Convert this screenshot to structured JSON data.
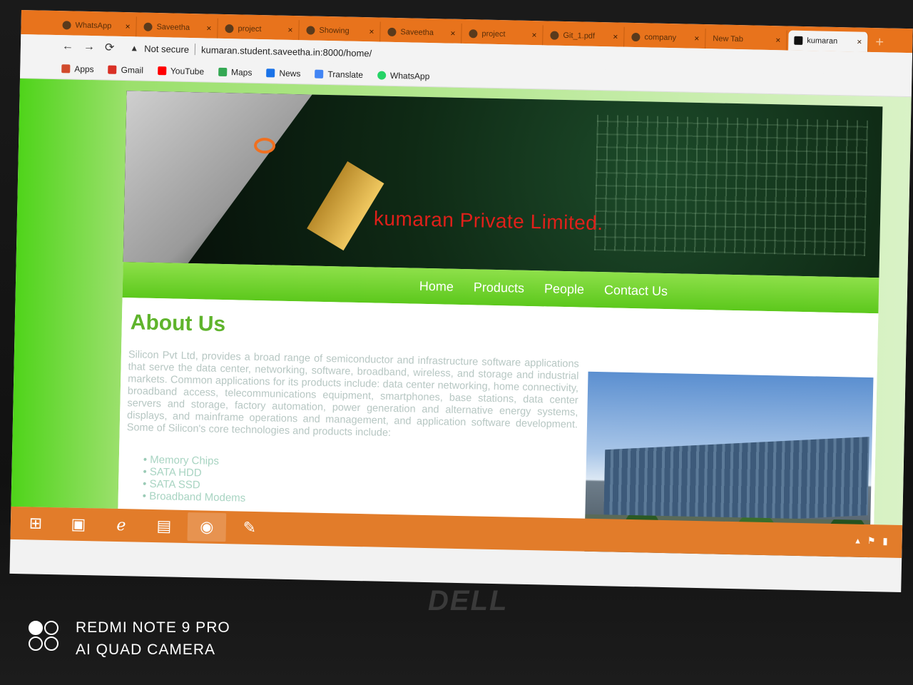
{
  "browser": {
    "tabs": [
      {
        "label": "WhatsApp"
      },
      {
        "label": "Saveetha"
      },
      {
        "label": "project"
      },
      {
        "label": "Showing"
      },
      {
        "label": "Saveetha"
      },
      {
        "label": "project"
      },
      {
        "label": "Git_1.pdf"
      },
      {
        "label": "company"
      },
      {
        "label": "New Tab"
      },
      {
        "label": "kumaran"
      }
    ],
    "security_label": "Not secure",
    "url": "kumaran.student.saveetha.in:8000/home/",
    "bookmarks": [
      {
        "label": "Apps",
        "icon": "apps-grid-icon",
        "color": "#d14b2c"
      },
      {
        "label": "Gmail",
        "icon": "gmail-icon",
        "color": "#d93025"
      },
      {
        "label": "YouTube",
        "icon": "youtube-icon",
        "color": "#ff0000"
      },
      {
        "label": "Maps",
        "icon": "maps-icon",
        "color": "#34a853"
      },
      {
        "label": "News",
        "icon": "news-icon",
        "color": "#1a73e8"
      },
      {
        "label": "Translate",
        "icon": "translate-icon",
        "color": "#4285f4"
      },
      {
        "label": "WhatsApp",
        "icon": "whatsapp-icon",
        "color": "#25d366"
      }
    ]
  },
  "site": {
    "banner_title": "kumaran Private Limited.",
    "nav": [
      {
        "label": "Home"
      },
      {
        "label": "Products"
      },
      {
        "label": "People"
      },
      {
        "label": "Contact Us"
      }
    ],
    "heading": "About Us",
    "about_text": "Silicon Pvt Ltd, provides a broad range of semiconductor and infrastructure software applications that serve the data center, networking, software, broadband, wireless, and storage and industrial markets. Common applications for its products include: data center networking, home connectivity, broadband access, telecommunications equipment, smartphones, base stations, data center servers and storage, factory automation, power generation and alternative energy systems, displays, and mainframe operations and management, and application software development. Some of Silicon's core technologies and products include:",
    "products": [
      "Memory Chips",
      "SATA HDD",
      "SATA SSD",
      "Broadband Modems"
    ]
  },
  "taskbar": {
    "items": [
      {
        "icon": "windows-start-icon"
      },
      {
        "icon": "store-icon"
      },
      {
        "icon": "internet-explorer-icon"
      },
      {
        "icon": "file-explorer-icon"
      },
      {
        "icon": "chrome-icon"
      },
      {
        "icon": "paint-icon"
      }
    ]
  },
  "device": {
    "laptop_brand": "DELL",
    "watermark_line1": "REDMI NOTE 9 PRO",
    "watermark_line2": "AI QUAD CAMERA"
  },
  "colors": {
    "tab_strip": "#e8731c",
    "nav_green": "#5cc81c",
    "heading_green": "#5fb42c",
    "banner_title": "#e0201a"
  }
}
